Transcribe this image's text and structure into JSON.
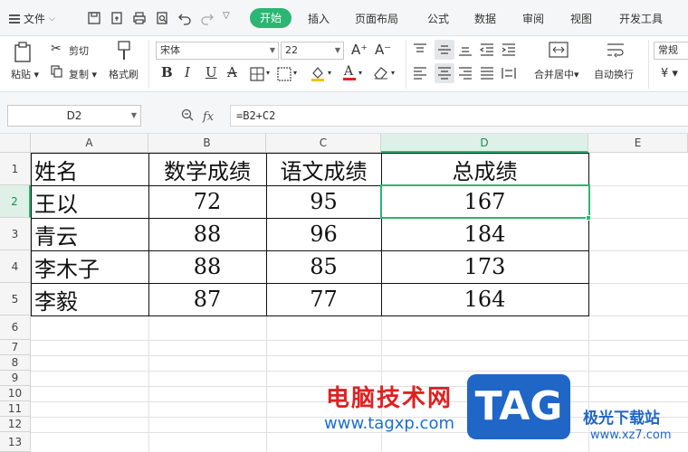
{
  "menubar": {
    "file_label": "文件",
    "tabs": [
      "开始",
      "插入",
      "页面布局",
      "公式",
      "数据",
      "审阅",
      "视图",
      "开发工具"
    ]
  },
  "ribbon": {
    "paste_label": "粘贴",
    "cut_label": "剪切",
    "copy_label": "复制",
    "format_painter_label": "格式刷",
    "font_name": "宋体",
    "font_size": "22",
    "merge_label": "合并居中",
    "wrap_label": "自动换行",
    "number_format": "常规",
    "currency_symbol": "¥"
  },
  "formula_bar": {
    "name_box": "D2",
    "fx_label": "fx",
    "formula": "=B2+C2"
  },
  "sheet": {
    "columns": [
      "A",
      "B",
      "C",
      "D",
      "E"
    ],
    "active_column": "D",
    "rows": [
      "1",
      "2",
      "3",
      "4",
      "5",
      "6",
      "7",
      "8",
      "9",
      "10",
      "11",
      "12",
      "13"
    ],
    "active_row": "2",
    "header": [
      "姓名",
      "数学成绩",
      "语文成绩",
      "总成绩"
    ],
    "data": [
      [
        "王以",
        "72",
        "95",
        "167"
      ],
      [
        "青云",
        "88",
        "96",
        "184"
      ],
      [
        "李木子",
        "88",
        "85",
        "173"
      ],
      [
        "李毅",
        "87",
        "77",
        "164"
      ]
    ]
  },
  "watermark": {
    "title": "电脑技术网",
    "url": "www.tagxp.com",
    "badge": "TAG",
    "site_name": "极光下载站",
    "site_url": "www.xz7.com"
  },
  "colors": {
    "accent": "#2bb673",
    "watermark_red": "#e02020",
    "watermark_blue": "#1f66c7"
  }
}
